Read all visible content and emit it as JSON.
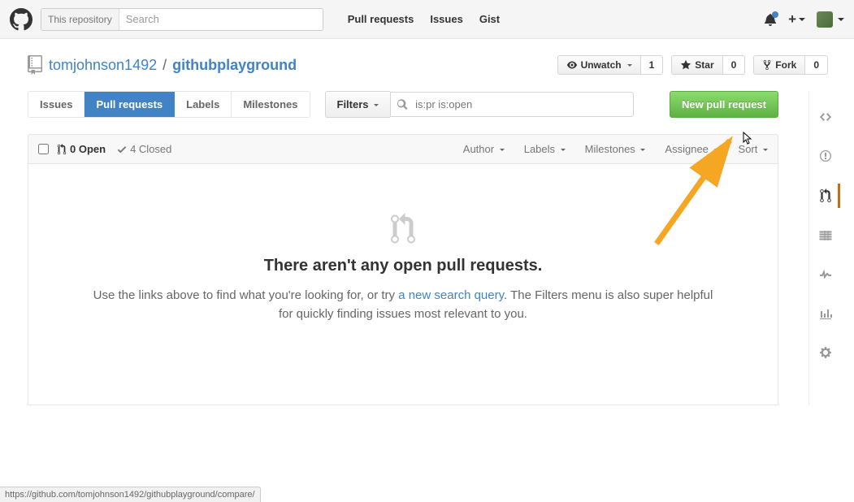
{
  "header": {
    "search_scope": "This repository",
    "search_placeholder": "Search",
    "nav": {
      "pull_requests": "Pull requests",
      "issues": "Issues",
      "gist": "Gist"
    }
  },
  "repo": {
    "owner": "tomjohnson1492",
    "name": "githubplayground",
    "actions": {
      "watch_label": "Unwatch",
      "watch_count": "1",
      "star_label": "Star",
      "star_count": "0",
      "fork_label": "Fork",
      "fork_count": "0"
    }
  },
  "tabs": {
    "issues": "Issues",
    "pull_requests": "Pull requests",
    "labels": "Labels",
    "milestones": "Milestones"
  },
  "filters": {
    "button": "Filters",
    "value": "is:pr is:open"
  },
  "new_pr_button": "New pull request",
  "list_header": {
    "open": "0 Open",
    "closed": "4 Closed",
    "filters": [
      "Author",
      "Labels",
      "Milestones",
      "Assignee",
      "Sort"
    ]
  },
  "blankslate": {
    "title": "There aren't any open pull requests.",
    "text_before": "Use the links above to find what you're looking for, or try ",
    "link": "a new search query",
    "text_after": ". The Filters menu is also super helpful for quickly finding issues most relevant to you."
  },
  "status_bar": "https://github.com/tomjohnson1492/githubplayground/compare/"
}
